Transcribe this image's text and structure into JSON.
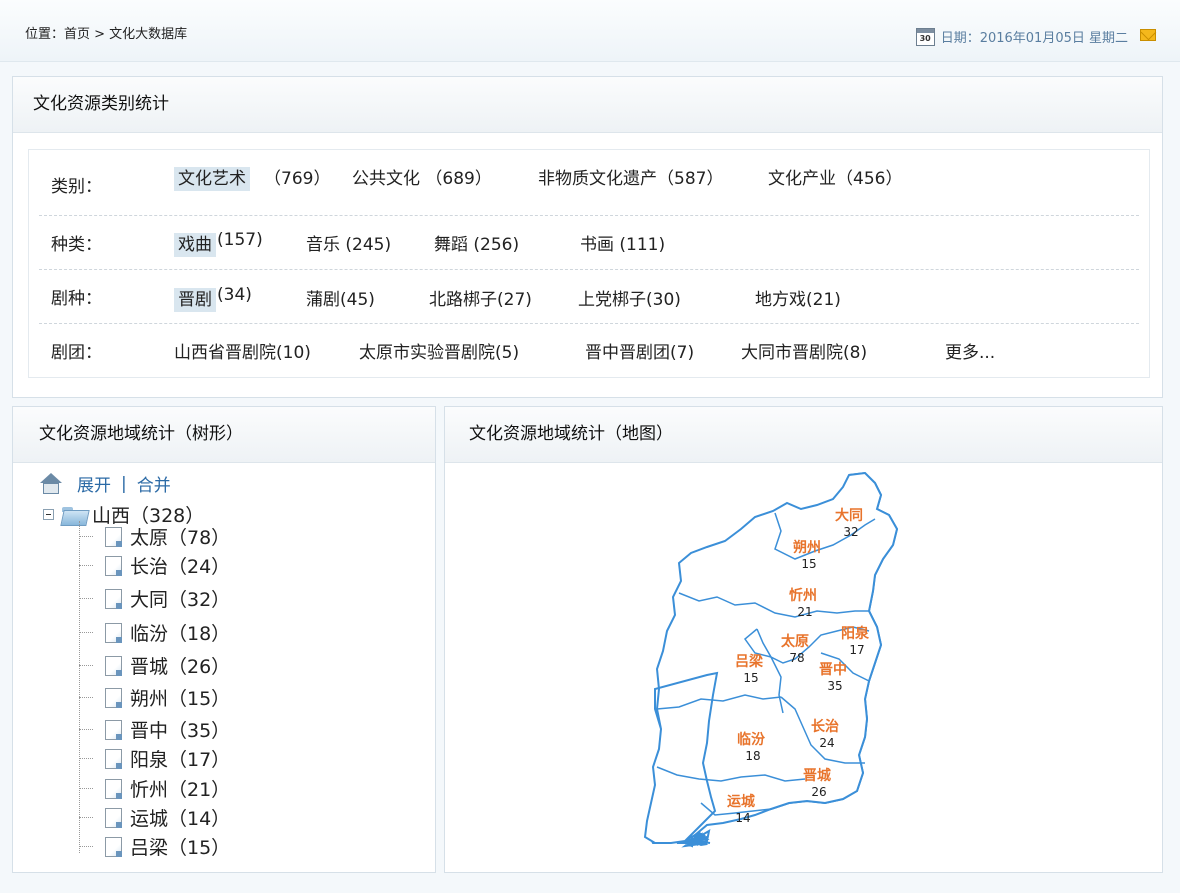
{
  "header": {
    "location": "位置：首页 > 文化大数据库",
    "date": "日期：2016年01月05日  星期二",
    "calendar_day": "30"
  },
  "category_panel": {
    "title": "文化资源类别统计",
    "rows": [
      {
        "label": "类别：",
        "items": [
          "文化艺术",
          "（769）",
          "公共文化 （689）",
          "非物质文化遗产（587）",
          "文化产业（456）"
        ]
      },
      {
        "label": "种类：",
        "items": [
          "戏曲",
          "(157)",
          "音乐 (245)",
          "舞蹈 (256)",
          "书画 (111)"
        ]
      },
      {
        "label": "剧种：",
        "items": [
          "晋剧",
          "(34)",
          "蒲剧(45)",
          "北路梆子(27)",
          "上党梆子(30)",
          "地方戏(21)"
        ]
      },
      {
        "label": "剧团：",
        "items": [
          "山西省晋剧院(10)",
          "太原市实验晋剧院(5)",
          "晋中晋剧团(7)",
          "大同市晋剧院(8)",
          "更多..."
        ]
      }
    ]
  },
  "tree_panel": {
    "title": "文化资源地域统计（树形）",
    "expand": "展开",
    "separator": "|",
    "collapse": "合并",
    "root": "山西（328）",
    "children": [
      "太原（78）",
      "长治（24）",
      "大同（32）",
      "临汾（18）",
      "晋城（26）",
      "朔州（15）",
      "晋中（35）",
      "阳泉（17）",
      "忻州（21）",
      "运城（14）",
      "吕梁（15）"
    ]
  },
  "map_panel": {
    "title": "文化资源地域统计（地图）",
    "regions": [
      {
        "name": "大同",
        "value": "32"
      },
      {
        "name": "朔州",
        "value": "15"
      },
      {
        "name": "忻州",
        "value": "21"
      },
      {
        "name": "阳泉",
        "value": "17"
      },
      {
        "name": "太原",
        "value": "78"
      },
      {
        "name": "吕梁",
        "value": "15"
      },
      {
        "name": "晋中",
        "value": "35"
      },
      {
        "name": "长治",
        "value": "24"
      },
      {
        "name": "临汾",
        "value": "18"
      },
      {
        "name": "晋城",
        "value": "26"
      },
      {
        "name": "运城",
        "value": "14"
      }
    ],
    "colors": {
      "border": "#3b8fd8",
      "label": "#e8742c"
    }
  }
}
